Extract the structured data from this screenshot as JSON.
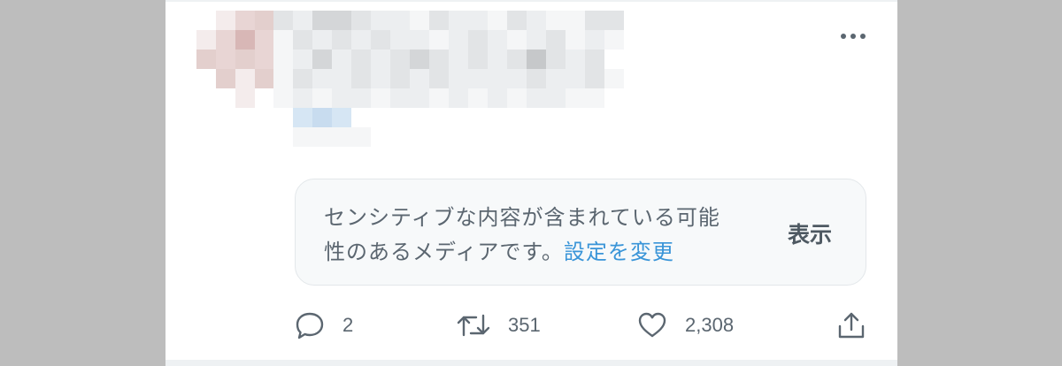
{
  "tweet": {
    "author_avatar": "pixelated",
    "body": "pixelated",
    "more_icon": "more-horizontal-icon",
    "sensitive_notice": {
      "message": "センシティブな内容が含まれている可能性のあるメディアです。",
      "change_settings_label": "設定を変更",
      "show_label": "表示",
      "link_color": "#3a95d8"
    },
    "actions": {
      "reply": {
        "icon": "reply-icon",
        "count": "2"
      },
      "retweet": {
        "icon": "retweet-icon",
        "count": "351"
      },
      "like": {
        "icon": "heart-icon",
        "count": "2,308"
      },
      "share": {
        "icon": "share-icon"
      }
    }
  },
  "colors": {
    "page_bg": "#bdbdbd",
    "card_bg": "#ffffff",
    "notice_bg": "#f7f9fa",
    "icon_gray": "#5b6670"
  }
}
